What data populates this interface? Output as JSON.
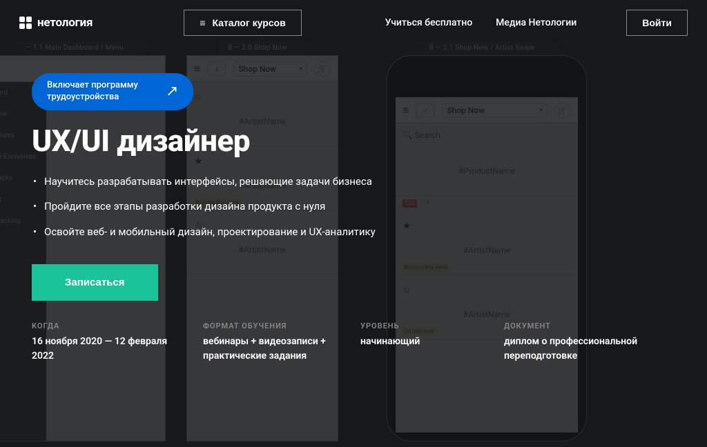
{
  "header": {
    "brand": "нетология",
    "catalog_label": "Каталог курсов",
    "nav": {
      "free": "Учиться бесплатно",
      "media": "Медиа Нетологии"
    },
    "login_label": "Войти"
  },
  "hero": {
    "badge_text": "Включает программу трудоустройства",
    "title": "UX/UI дизайнер",
    "bullets": [
      "Научитесь разрабатывать интерфейсы, решающие задачи бизнеса",
      "Пройдите все этапы разработки дизайна продукта с нуля",
      "Освойте веб- и мобильный дизайн, проектирование и UX-аналитику"
    ],
    "cta_label": "Записаться"
  },
  "info": {
    "when_label": "КОГДА",
    "when_value": "16 ноября 2020 — 12 февраля 2022",
    "format_label": "ФОРМАТ ОБУЧЕНИЯ",
    "format_value": "вебинары + видеозаписи + практические задания",
    "level_label": "УРОВЕНЬ",
    "level_value": "начинающий",
    "doc_label": "ДОКУМЕНТ",
    "doc_value": "диплом о профессиональной переподготовке"
  },
  "wireframes": {
    "tab_left": "— 1.1   Main Dashboard / Menu",
    "tab_mid": "B — 2.0   Shop Now",
    "tab_right": "B — 2.1   Shop Now / Artist Swipe",
    "shop_now": "Shop Now",
    "search": "Search",
    "product_name": "#ProductName",
    "artist_name": "#ArtistName",
    "on_tour": "On tour now",
    "buzzing": "Buzzing this week",
    "price_tag": "$20",
    "qty": "1",
    "sidebar_items": [
      "ard",
      "ow",
      "Sales",
      "o Exclusives",
      "acks",
      "s",
      "racking"
    ]
  }
}
